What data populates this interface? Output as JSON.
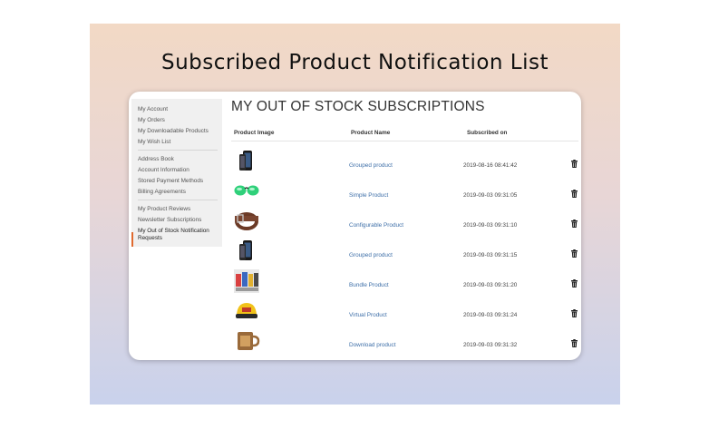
{
  "banner": {
    "title": "Subscribed Product Notification List"
  },
  "sidebar": {
    "group1": [
      "My Account",
      "My Orders",
      "My Downloadable Products",
      "My Wish List"
    ],
    "group2": [
      "Address Book",
      "Account Information",
      "Stored Payment Methods",
      "Billing Agreements"
    ],
    "group3": [
      "My Product Reviews",
      "Newsletter Subscriptions"
    ],
    "active": {
      "line1": "My Out of Stock Notification",
      "line2": "Requests"
    }
  },
  "main": {
    "title": "MY OUT OF STOCK SUBSCRIPTIONS",
    "columns": {
      "image": "Product Image",
      "name": "Product Name",
      "subscribed": "Subscribed on"
    },
    "rows": [
      {
        "name": "Grouped product",
        "date": "2019-08-16 08:41:42",
        "image_icon": "phone-icon"
      },
      {
        "name": "Simple Product",
        "date": "2019-09-03 09:31:05",
        "image_icon": "sunglasses-icon"
      },
      {
        "name": "Configurable Product",
        "date": "2019-09-03 09:31:10",
        "image_icon": "belt-icon"
      },
      {
        "name": "Grouped product",
        "date": "2019-09-03 09:31:15",
        "image_icon": "phone-icon"
      },
      {
        "name": "Bundle Product",
        "date": "2019-09-03 09:31:20",
        "image_icon": "bundle-icon"
      },
      {
        "name": "Virtual Product",
        "date": "2019-09-03 09:31:24",
        "image_icon": "cap-icon"
      },
      {
        "name": "Download product",
        "date": "2019-09-03 09:31:32",
        "image_icon": "mug-icon"
      }
    ]
  },
  "colors": {
    "accent": "#e06a2f",
    "link": "#3e6fa8"
  }
}
